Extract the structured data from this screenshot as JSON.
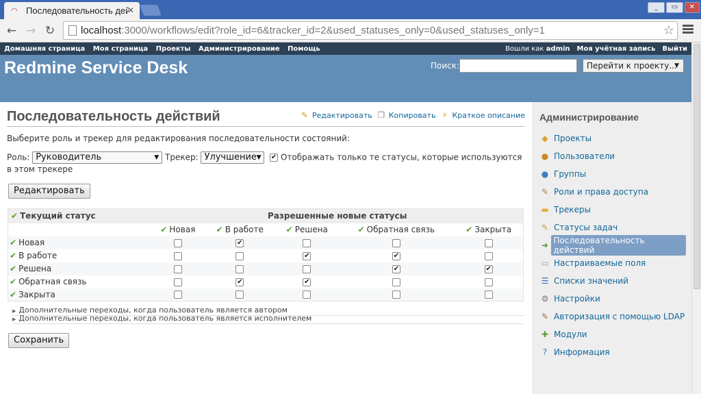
{
  "browser": {
    "tab_title": "Последовательность дей",
    "url_host": "localhost",
    "url_rest": ":3000/workflows/edit?role_id=6&tracker_id=2&used_statuses_only=0&used_statuses_only=1"
  },
  "top_menu": {
    "left": [
      "Домашняя страница",
      "Моя страница",
      "Проекты",
      "Администрирование",
      "Помощь"
    ],
    "logged_as": "Вошли как",
    "user": "admin",
    "my_account": "Моя учётная запись",
    "logout": "Выйти"
  },
  "header": {
    "title": "Redmine Service Desk",
    "search_label": "Поиск:",
    "search_value": "",
    "jump_label": "Перейти к проекту..."
  },
  "content": {
    "title": "Последовательность действий",
    "actions": {
      "edit": "Редактировать",
      "copy": "Копировать",
      "summary": "Краткое описание"
    },
    "intro": "Выберите роль и трекер для редактирования последовательности состояний:",
    "role_label": "Роль:",
    "role_value": "Руководитель",
    "tracker_label": "Трекер:",
    "tracker_value": "Улучшение",
    "used_only_label": "Отображать только те статусы, которые используются в этом трекере",
    "used_only_checked": true,
    "edit_button": "Редактировать",
    "save_button": "Сохранить",
    "extra_author": "Дополнительные переходы, когда пользователь является автором",
    "extra_assignee": "Дополнительные переходы, когда пользователь является исполнителем"
  },
  "workflow_table": {
    "current_status_header": "Текущий статус",
    "allowed_header": "Разрешенные новые статусы",
    "columns": [
      "Новая",
      "В работе",
      "Решена",
      "Обратная связь",
      "Закрыта"
    ],
    "rows": [
      {
        "status": "Новая",
        "checks": [
          false,
          true,
          false,
          false,
          false
        ]
      },
      {
        "status": "В работе",
        "checks": [
          false,
          false,
          true,
          true,
          false
        ]
      },
      {
        "status": "Решена",
        "checks": [
          false,
          false,
          false,
          true,
          true
        ]
      },
      {
        "status": "Обратная связь",
        "checks": [
          false,
          true,
          true,
          false,
          false
        ]
      },
      {
        "status": "Закрыта",
        "checks": [
          false,
          false,
          false,
          false,
          false
        ]
      }
    ]
  },
  "sidebar": {
    "title": "Администрирование",
    "items": [
      {
        "label": "Проекты",
        "icon": "projects-icon",
        "glyph": "◆",
        "color": "#e0a030"
      },
      {
        "label": "Пользователи",
        "icon": "user-icon",
        "glyph": "●",
        "color": "#c98a2a"
      },
      {
        "label": "Группы",
        "icon": "group-icon",
        "glyph": "●",
        "color": "#3a7fc0"
      },
      {
        "label": "Роли и права доступа",
        "icon": "key-icon",
        "glyph": "✎",
        "color": "#b08040"
      },
      {
        "label": "Трекеры",
        "icon": "ticket-icon",
        "glyph": "▬",
        "color": "#e0b040"
      },
      {
        "label": "Статусы задач",
        "icon": "status-icon",
        "glyph": "✎",
        "color": "#c0a040"
      },
      {
        "label": "Последовательность действий",
        "icon": "workflow-icon",
        "glyph": "➜",
        "color": "#4a9a30",
        "selected": true
      },
      {
        "label": "Настраиваемые поля",
        "icon": "custom-field-icon",
        "glyph": "▭",
        "color": "#999999"
      },
      {
        "label": "Списки значений",
        "icon": "list-icon",
        "glyph": "☰",
        "color": "#3a70b0"
      },
      {
        "label": "Настройки",
        "icon": "gear-icon",
        "glyph": "⚙",
        "color": "#777777"
      },
      {
        "label": "Авторизация с помощью LDAP",
        "icon": "ldap-icon",
        "glyph": "✎",
        "color": "#a07040"
      },
      {
        "label": "Модули",
        "icon": "plugin-icon",
        "glyph": "✚",
        "color": "#5aa030"
      },
      {
        "label": "Информация",
        "icon": "info-icon",
        "glyph": "?",
        "color": "#3a70c0"
      }
    ]
  }
}
